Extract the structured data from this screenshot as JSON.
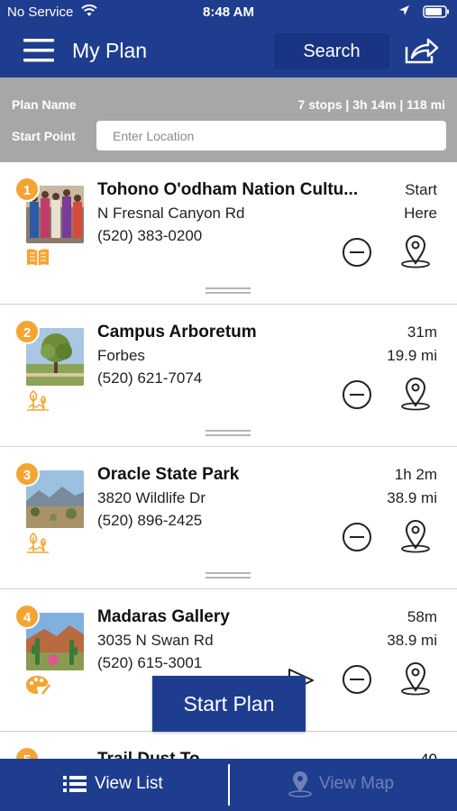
{
  "status_bar": {
    "carrier": "No Service",
    "time": "8:48 AM"
  },
  "header": {
    "title": "My Plan",
    "search_label": "Search",
    "icons": [
      "hamburger-menu-icon",
      "share-icon"
    ]
  },
  "plan": {
    "name_label": "Plan Name",
    "summary": "7 stops | 3h 14m | 118 mi",
    "start_label": "Start Point",
    "start_placeholder": "Enter Location"
  },
  "stops": [
    {
      "number": "1",
      "name": "Tohono O'odham Nation Cultu...",
      "address": "N Fresnal Canyon Rd",
      "phone": "(520) 383-0200",
      "time": "Start",
      "distance": "Here",
      "category_icon": "book-icon"
    },
    {
      "number": "2",
      "name": "Campus Arboretum",
      "address": "Forbes",
      "phone": "(520) 621-7074",
      "time": "31m",
      "distance": "19.9 mi",
      "category_icon": "nature-icon"
    },
    {
      "number": "3",
      "name": "Oracle State Park",
      "address": "3820 Wildlife Dr",
      "phone": "(520) 896-2425",
      "time": "1h 2m",
      "distance": "38.9 mi",
      "category_icon": "nature-icon"
    },
    {
      "number": "4",
      "name": "Madaras Gallery",
      "address": "3035 N Swan Rd",
      "phone": "(520) 615-3001",
      "time": "58m",
      "distance": "38.9 mi",
      "category_icon": "palette-icon"
    }
  ],
  "next_stop_peek": {
    "number": "5",
    "name": "Trail Dust To",
    "time": "40"
  },
  "start_plan_label": "Start Plan",
  "tabs": {
    "list_label": "View List",
    "map_label": "View Map"
  },
  "colors": {
    "brand_blue": "#1f3d8f",
    "accent_orange": "#f3a533",
    "panel_gray": "#a7a7a7"
  }
}
